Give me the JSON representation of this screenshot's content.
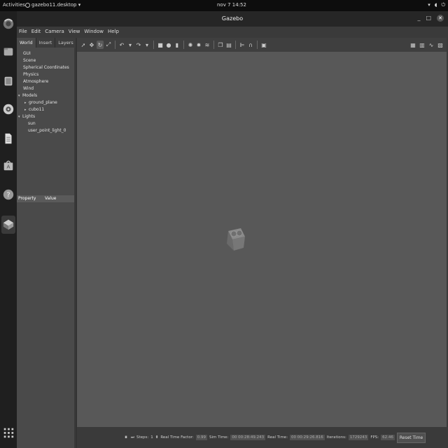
{
  "topbar": {
    "activities": "Activities",
    "app_menu": "gazebo11.desktop ▾",
    "clock": "nov 7  14:52"
  },
  "dock": {
    "icons": [
      "firefox-icon",
      "files-icon",
      "storage-icon",
      "rhythmbox-icon",
      "document-icon",
      "software-icon",
      "help-icon",
      "gazebo-icon",
      "apps-grid-icon"
    ]
  },
  "window": {
    "title": "Gazebo",
    "menu": [
      "File",
      "Edit",
      "Camera",
      "View",
      "Window",
      "Help"
    ]
  },
  "left_panel": {
    "tabs": [
      "World",
      "Insert",
      "Layers"
    ],
    "tree": [
      {
        "label": "GUI",
        "indent": 1,
        "arrow": ""
      },
      {
        "label": "Scene",
        "indent": 1,
        "arrow": ""
      },
      {
        "label": "Spherical Coordinates",
        "indent": 1,
        "arrow": ""
      },
      {
        "label": "Physics",
        "indent": 1,
        "arrow": ""
      },
      {
        "label": "Atmosphere",
        "indent": 1,
        "arrow": ""
      },
      {
        "label": "Wind",
        "indent": 1,
        "arrow": ""
      },
      {
        "label": "Models",
        "indent": 0,
        "arrow": "▾"
      },
      {
        "label": "ground_plane",
        "indent": 2,
        "arrow": "▸"
      },
      {
        "label": "cubo11",
        "indent": 2,
        "arrow": "▸"
      },
      {
        "label": "Lights",
        "indent": 0,
        "arrow": "▾"
      },
      {
        "label": "sun",
        "indent": 3,
        "arrow": ""
      },
      {
        "label": "user_point_light_0",
        "indent": 3,
        "arrow": ""
      }
    ],
    "property_header": "Property",
    "value_header": "Value"
  },
  "bottom_bar": {
    "steps_label": "Steps:",
    "steps_value": "1",
    "rtf_label": "Real Time Factor:",
    "rtf_value": "0.99",
    "sim_time_label": "Sim Time:",
    "sim_time_value": "00 00:28:49.243",
    "real_time_label": "Real Time:",
    "real_time_value": "00 00:29:26.816",
    "iterations_label": "Iterations:",
    "iterations_value": "1729243",
    "fps_label": "FPS:",
    "fps_value": "62.46",
    "reset_label": "Reset Time"
  }
}
